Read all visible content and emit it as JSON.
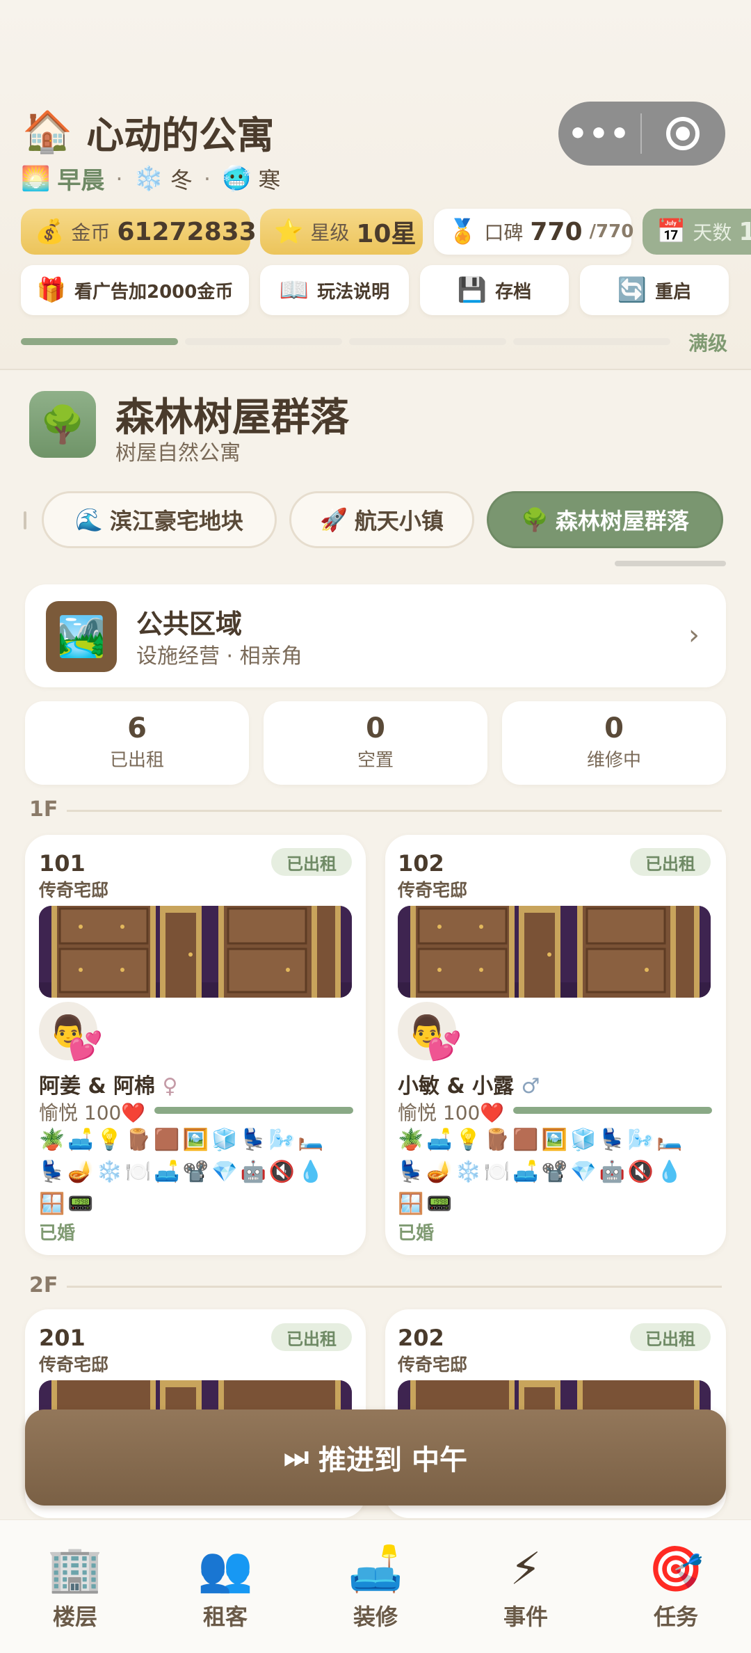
{
  "header": {
    "app_icon": "house-icon",
    "app_title": "心动的公寓",
    "capsule_more": "•••",
    "time_icon": "sunrise-icon",
    "time_of_day": "早晨",
    "season_icon": "snowflake-icon",
    "season": "冬",
    "temp_icon": "cold-face-icon",
    "temperature": "寒",
    "separator": "·"
  },
  "stats": {
    "coins_label": "金币",
    "coins_value": "61272833",
    "star_label": "星级",
    "star_value": "10星",
    "reputation_label": "口碑",
    "reputation_value": "770",
    "reputation_max": "/770",
    "days_label": "天数",
    "days_value": "1"
  },
  "actions": {
    "ad_coins": "看广告加2000金币",
    "rules": "玩法说明",
    "save": "存档",
    "restart": "重启"
  },
  "level": {
    "label": "满级",
    "segments_filled": 1,
    "segments_total": 4
  },
  "building": {
    "name": "森林树屋群落",
    "subtitle": "树屋自然公寓",
    "tabs": [
      "滨江豪宅地块",
      "航天小镇",
      "森林树屋群落"
    ],
    "active_tab": 2
  },
  "public_area": {
    "title": "公共区域",
    "subtitle": "设施经营 · 相亲角"
  },
  "occupancy": [
    {
      "value": "6",
      "label": "已出租"
    },
    {
      "value": "0",
      "label": "空置"
    },
    {
      "value": "0",
      "label": "维修中"
    }
  ],
  "floors": [
    {
      "label": "1F",
      "rooms": [
        {
          "number": "101",
          "type": "传奇宅邸",
          "status": "已出租",
          "tenants": "阿姜 & 阿棉",
          "gender": "♀",
          "mood": "愉悦 100❤️",
          "mood_value": 100,
          "items": "🪴🛋️💡🪵🟫🖼️🧊💺🌬️🛏️💺🪔❄️🍽️🛋️📽️💎🤖🔇💧🪟📟",
          "relationship": "已婚"
        },
        {
          "number": "102",
          "type": "传奇宅邸",
          "status": "已出租",
          "tenants": "小敏 & 小露",
          "gender": "♂",
          "mood": "愉悦 100❤️",
          "mood_value": 100,
          "items": "🪴🛋️💡🪵🟫🖼️🧊💺🌬️🛏️💺🪔❄️🍽️🛋️📽️💎🤖🔇💧🪟📟",
          "relationship": "已婚"
        }
      ]
    },
    {
      "label": "2F",
      "rooms": [
        {
          "number": "201",
          "type": "传奇宅邸",
          "status": "已出租"
        },
        {
          "number": "202",
          "type": "传奇宅邸",
          "status": "已出租"
        }
      ]
    }
  ],
  "advance_button": "推进到 中午",
  "nav": [
    {
      "label": "楼层",
      "icon": "building-icon"
    },
    {
      "label": "租客",
      "icon": "people-icon"
    },
    {
      "label": "装修",
      "icon": "sofa-icon"
    },
    {
      "label": "事件",
      "icon": "lightning-icon"
    },
    {
      "label": "任务",
      "icon": "target-icon"
    }
  ]
}
